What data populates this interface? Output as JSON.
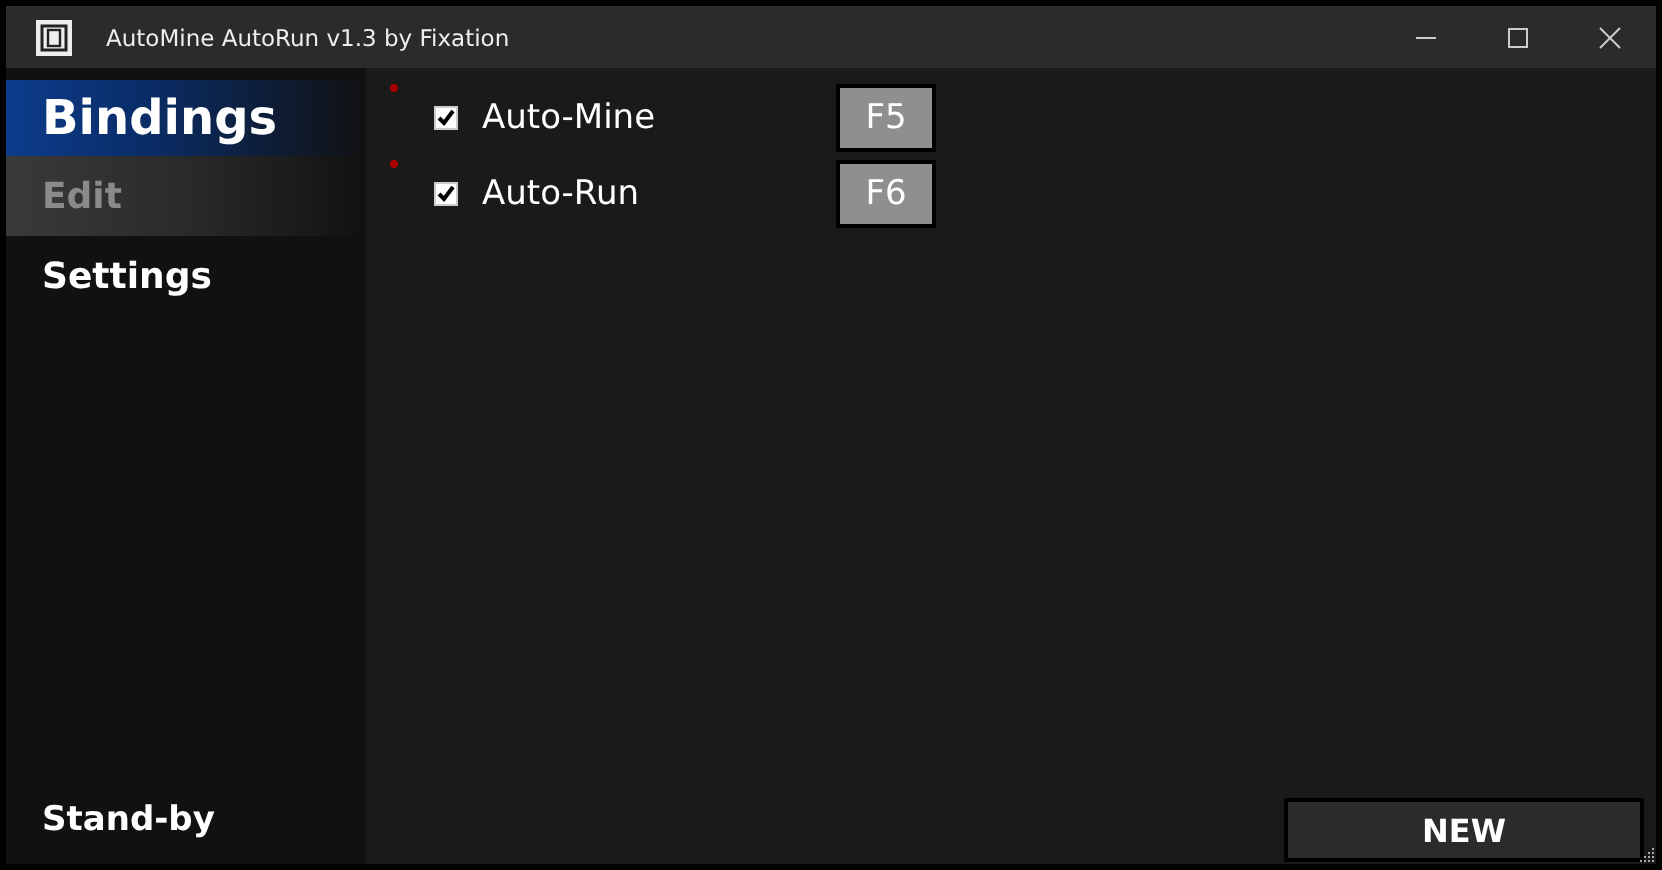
{
  "window": {
    "title": "AutoMine AutoRun v1.3 by Fixation"
  },
  "sidebar": {
    "items": [
      {
        "label": "Bindings",
        "selected": true,
        "disabled": false
      },
      {
        "label": "Edit",
        "selected": false,
        "disabled": true
      },
      {
        "label": "Settings",
        "selected": false,
        "disabled": false
      }
    ]
  },
  "bindings": [
    {
      "name": "Auto-Mine",
      "checked": true,
      "key": "F5"
    },
    {
      "name": "Auto-Run",
      "checked": true,
      "key": "F6"
    }
  ],
  "status_bar": {
    "status": "Stand-by",
    "button": "NEW"
  }
}
